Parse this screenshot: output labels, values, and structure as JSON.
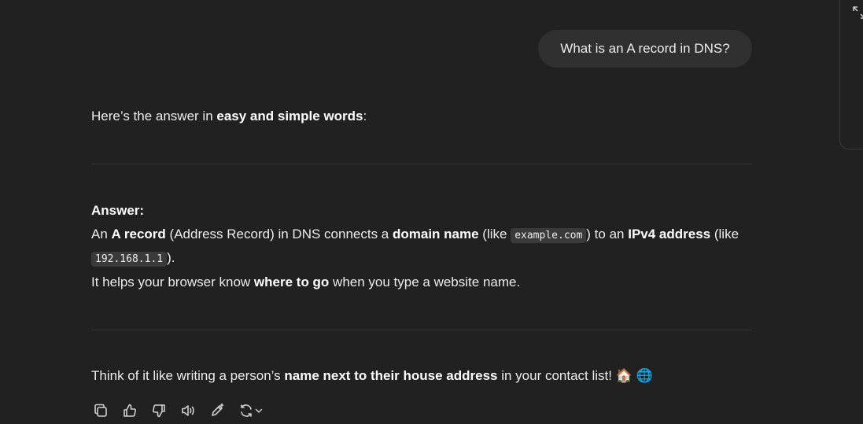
{
  "user_message": "What is an A record in DNS?",
  "assistant": {
    "intro_plain": "Here’s the answer in ",
    "intro_bold": "easy and simple words",
    "intro_end": ":",
    "answer_heading": "Answer:",
    "p1_a": "An ",
    "p1_b": "A record",
    "p1_c": " (Address Record) in DNS connects a ",
    "p1_d": "domain name",
    "p1_e": " (like ",
    "p1_code1": "example.com",
    "p1_f": ") to an ",
    "p1_g": "IPv4 address",
    "p1_h": " (like",
    "p1_code2": "192.168.1.1",
    "p1_i": ").",
    "p2_a": "It helps your browser know ",
    "p2_b": "where to go",
    "p2_c": " when you type a website name.",
    "p3_a": "Think of it like writing a person’s ",
    "p3_b": "name next to their house address",
    "p3_c": " in your contact list! ",
    "p3_emoji": "🏠 🌐"
  },
  "actions": {
    "icons": [
      "copy-icon",
      "thumbs-up-icon",
      "thumbs-down-icon",
      "read-aloud-icon",
      "edit-icon",
      "regenerate-icon"
    ]
  }
}
